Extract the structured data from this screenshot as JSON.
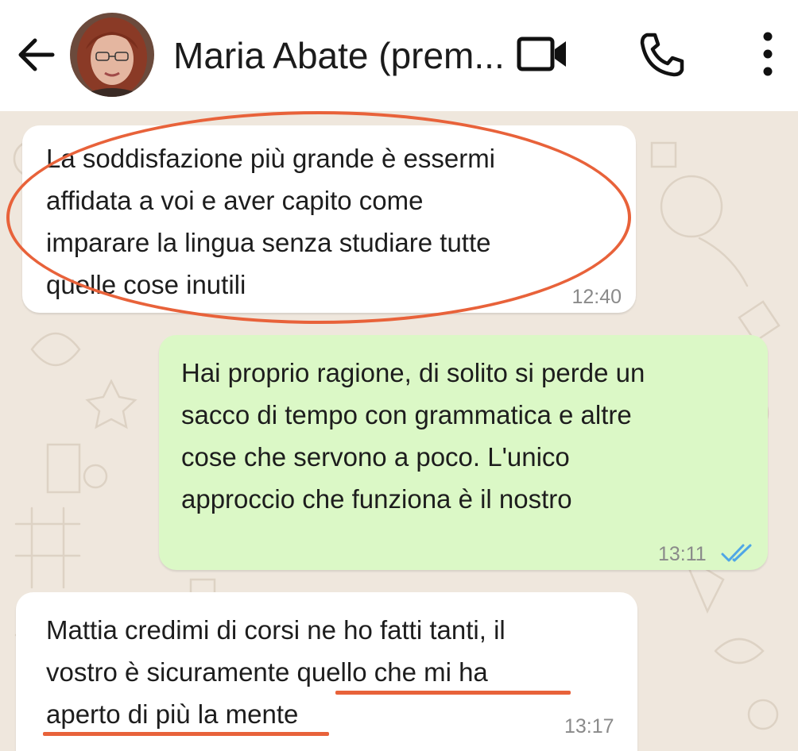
{
  "header": {
    "contact_name": "Maria Abate (prem..."
  },
  "messages": [
    {
      "direction": "incoming",
      "lines": [
        "La soddisfazione più grande è essermi",
        "affidata a voi e aver capito come",
        "imparare la lingua senza studiare tutte",
        "quelle cose inutili"
      ],
      "time": "12:40"
    },
    {
      "direction": "outgoing",
      "lines": [
        "Hai proprio ragione, di solito si perde un",
        "sacco di tempo con grammatica e altre",
        "cose che servono a poco. L'unico",
        "approccio che funziona è il nostro"
      ],
      "time": "13:11",
      "status": "read"
    },
    {
      "direction": "incoming",
      "lines": [
        "Mattia credimi di corsi ne ho fatti tanti, il",
        "vostro è sicuramente quello che mi ha",
        "aperto di più la mente"
      ],
      "time": "13:17"
    }
  ],
  "colors": {
    "highlight": "#e8623a",
    "incoming_bubble": "#ffffff",
    "outgoing_bubble": "#dbf8c6",
    "chat_background": "#efe7dd",
    "read_ticks": "#4fa6e6"
  },
  "icons": {
    "back": "arrow-left-icon",
    "video": "video-camera-icon",
    "call": "phone-icon",
    "menu": "more-vertical-icon"
  }
}
